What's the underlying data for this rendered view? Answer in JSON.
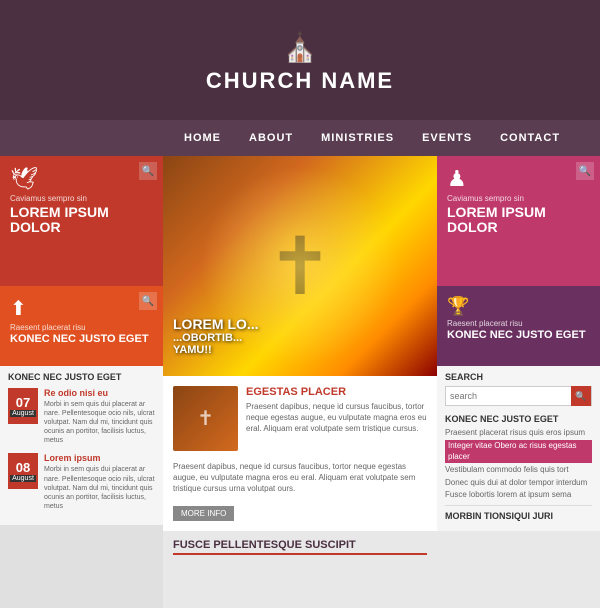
{
  "header": {
    "church_name": "CHURCH NAME",
    "church_icon": "⛪"
  },
  "nav": {
    "items": [
      {
        "label": "HOME"
      },
      {
        "label": "ABOUT"
      },
      {
        "label": "MINISTRIES"
      },
      {
        "label": "EVENTS"
      },
      {
        "label": "CONTACT"
      }
    ]
  },
  "left_sidebar": {
    "top_section": {
      "small_text": "Caviamus sempro sin",
      "big_text": "LOREM IPSUM DOLOR",
      "icon": "🕊"
    },
    "orange_section": {
      "small_text": "Raesent placerat risu",
      "big_text": "KONEC NEC JUSTO EGET",
      "icon": "⬆"
    },
    "posts_title": "KONEC NEC JUSTO EGET",
    "posts": [
      {
        "date_num": "07",
        "date_month": "August",
        "title": "Re odio nisi eu",
        "text": "Morbi in sem quis dui placerat ar nare. Pellentesoque ocio nils, ulcrat volutpat. Nam dul mi, tincidunt quis ocunis an portitor, facilisis luctus, metus"
      },
      {
        "date_num": "08",
        "date_month": "August",
        "title": "Lorem ipsum",
        "text": "Morbi in sem quis dui placerat ar nare. Pellentesoque ocio nils, ulcrat volutpat. Nam dul mi, tincidunt quis ocunis an portitor, facilisis luctus, metus"
      }
    ]
  },
  "center": {
    "hero_text": "LOREM LO...",
    "hero_sub": "...OBORTIB...",
    "hero_name": "YAMU!!",
    "article": {
      "title": "EGESTAS PLACER",
      "text": "Praesent dapibus, neque id cursus faucibus, tortor neque egestas augue, eu vulputate magna eros eu eral. Aliquam erat volutpate sem tristique cursus.",
      "text2": "Praesent dapibus, neque id cursus faucibus, tortor neque egestas augue, eu vulputate magna eros eu eral. Aliquam erat volutpate sem tristique cursus urna volutpat ours.",
      "more_info": "MORE INFO"
    },
    "section2_title": "FUSCE PELLENTESQUE SUSCIPIT"
  },
  "right_sidebar": {
    "top_section": {
      "small_text": "Caviamus sempro sin",
      "big_text": "LOREM IPSUM DOLOR",
      "icon": "♟"
    },
    "purple_section": {
      "small_text": "Raesent placerat risu",
      "big_text": "KONEC NEC JUSTO EGET",
      "icon": "🏆"
    },
    "search": {
      "label": "SEARCH",
      "placeholder": "search"
    },
    "section_title": "KONEC NEC JUSTO EGET",
    "links": [
      {
        "text": "Praesent placerat risus quis eros ipsum",
        "highlight": false
      },
      {
        "text": "Integer vitae Obero ac risus egestas placer",
        "highlight": true
      },
      {
        "text": "Vestibulam commodo felis quis tort",
        "highlight": false
      },
      {
        "text": "Donec quis dui at dolor tempor interdum",
        "highlight": false
      },
      {
        "text": "Fusce lobortis lorem at ipsum sema",
        "highlight": false
      }
    ],
    "section2_title": "MORBIN TIONSIQUI JURI"
  }
}
